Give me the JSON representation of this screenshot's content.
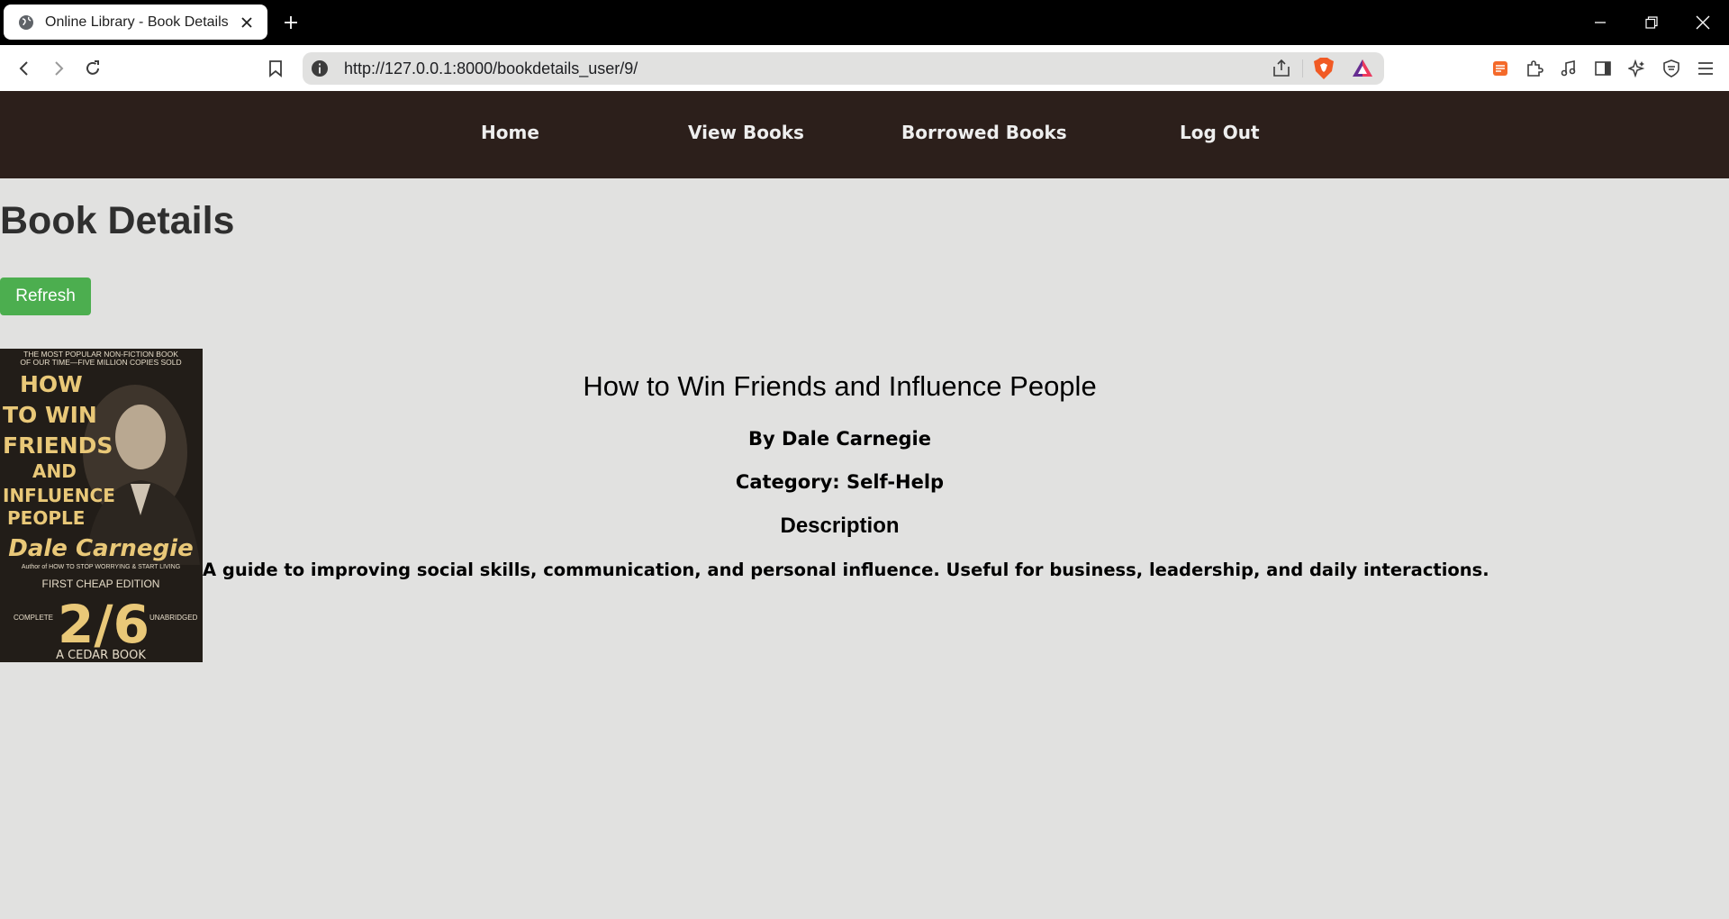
{
  "browser": {
    "tab_title": "Online Library - Book Details",
    "url": "http://127.0.0.1:8000/bookdetails_user/9/"
  },
  "nav": {
    "items": [
      {
        "label": "Home"
      },
      {
        "label": "View Books"
      },
      {
        "label": "Borrowed Books"
      },
      {
        "label": "Log Out"
      }
    ]
  },
  "page": {
    "title": "Book Details",
    "refresh_label": "Refresh"
  },
  "book": {
    "title": "How to Win Friends and Influence People",
    "author": "By Dale Carnegie",
    "category": "Category: Self-Help",
    "description_heading": "Description",
    "description": "A guide to improving social skills, communication, and personal influence. Useful for business, leadership, and daily interactions.",
    "cover": {
      "banner_line1": "THE MOST POPULAR NON-FICTION BOOK",
      "banner_line2": "OF OUR TIME—FIVE MILLION COPIES SOLD",
      "title_lines": [
        "HOW",
        "TO WIN",
        "FRIENDS",
        "AND",
        "INFLUENCE",
        "PEOPLE"
      ],
      "author": "Dale Carnegie",
      "author_note": "Author of HOW TO STOP WORRYING & START LIVING",
      "edition": "FIRST CHEAP EDITION",
      "left_label": "COMPLETE",
      "right_label": "UNABRIDGED",
      "price": "2/6",
      "publisher": "A CEDAR BOOK"
    }
  },
  "colors": {
    "nav_bg": "#2c1f1b",
    "page_bg": "#e1e1e0",
    "refresh_bg": "#4cae4f"
  }
}
